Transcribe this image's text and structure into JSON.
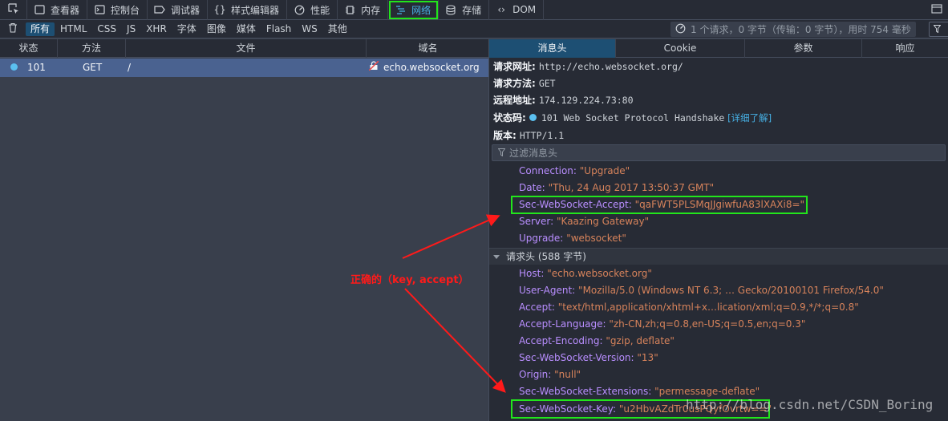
{
  "toolbar": {
    "tabs": [
      {
        "label": "查看器",
        "icon": "inspector-icon"
      },
      {
        "label": "控制台",
        "icon": "console-icon"
      },
      {
        "label": "调试器",
        "icon": "debugger-icon"
      },
      {
        "label": "样式编辑器",
        "icon": "style-editor-icon"
      },
      {
        "label": "性能",
        "icon": "performance-icon"
      },
      {
        "label": "内存",
        "icon": "memory-icon"
      },
      {
        "label": "网络",
        "icon": "network-icon"
      },
      {
        "label": "存储",
        "icon": "storage-icon"
      },
      {
        "label": "DOM",
        "icon": "dom-icon"
      }
    ],
    "active_tab": "网络",
    "accent_color": "#46afe3",
    "highlight_color": "#22e51c"
  },
  "filterbar": {
    "types": [
      "所有",
      "HTML",
      "CSS",
      "JS",
      "XHR",
      "字体",
      "图像",
      "媒体",
      "Flash",
      "WS",
      "其他"
    ],
    "active_type": "所有",
    "summary": "1 个请求，0 字节（传输：0 字节），用时 754 毫秒"
  },
  "requests": {
    "columns": [
      "状态",
      "方法",
      "文件",
      "域名"
    ],
    "rows": [
      {
        "status": "101",
        "method": "GET",
        "file": "/",
        "domain": "echo.websocket.org"
      }
    ]
  },
  "details": {
    "tabs": [
      "消息头",
      "Cookie",
      "参数",
      "响应"
    ],
    "active_tab": "消息头",
    "summary": [
      {
        "key": "请求网址:",
        "value": "http://echo.websocket.org/"
      },
      {
        "key": "请求方法:",
        "value": "GET"
      },
      {
        "key": "远程地址:",
        "value": "174.129.224.73:80"
      },
      {
        "key": "状态码:",
        "value": "101 Web Socket Protocol Handshake"
      },
      {
        "key": "版本:",
        "value": "HTTP/1.1"
      }
    ],
    "learn_more": "[详细了解]",
    "filter_placeholder": "过滤消息头",
    "response_headers": [
      {
        "name": "Connection:",
        "value": "\"Upgrade\""
      },
      {
        "name": "Date:",
        "value": "\"Thu, 24 Aug 2017 13:50:37 GMT\""
      },
      {
        "name": "Sec-WebSocket-Accept:",
        "value": "\"qaFWT5PLSMqJJgiwfuA83lXAXi8=\""
      },
      {
        "name": "Server:",
        "value": "\"Kaazing Gateway\""
      },
      {
        "name": "Upgrade:",
        "value": "\"websocket\""
      }
    ],
    "request_section": "请求头 (588 字节)",
    "request_headers": [
      {
        "name": "Host:",
        "value": "\"echo.websocket.org\""
      },
      {
        "name": "User-Agent:",
        "value": "\"Mozilla/5.0 (Windows NT 6.3; … Gecko/20100101 Firefox/54.0\""
      },
      {
        "name": "Accept:",
        "value": "\"text/html,application/xhtml+x…lication/xml;q=0.9,*/*;q=0.8\""
      },
      {
        "name": "Accept-Language:",
        "value": "\"zh-CN,zh;q=0.8,en-US;q=0.5,en;q=0.3\""
      },
      {
        "name": "Accept-Encoding:",
        "value": "\"gzip, deflate\""
      },
      {
        "name": "Sec-WebSocket-Version:",
        "value": "\"13\""
      },
      {
        "name": "Origin:",
        "value": "\"null\""
      },
      {
        "name": "Sec-WebSocket-Extensions:",
        "value": "\"permessage-deflate\""
      },
      {
        "name": "Sec-WebSocket-Key:",
        "value": "\"u2HbvAZdTr0usPQyfOvrtw==\""
      }
    ]
  },
  "annotation": {
    "text": "正确的（key, accept）",
    "color": "#ff1a1a"
  },
  "watermark": "http://blog.csdn.net/CSDN_Boring"
}
